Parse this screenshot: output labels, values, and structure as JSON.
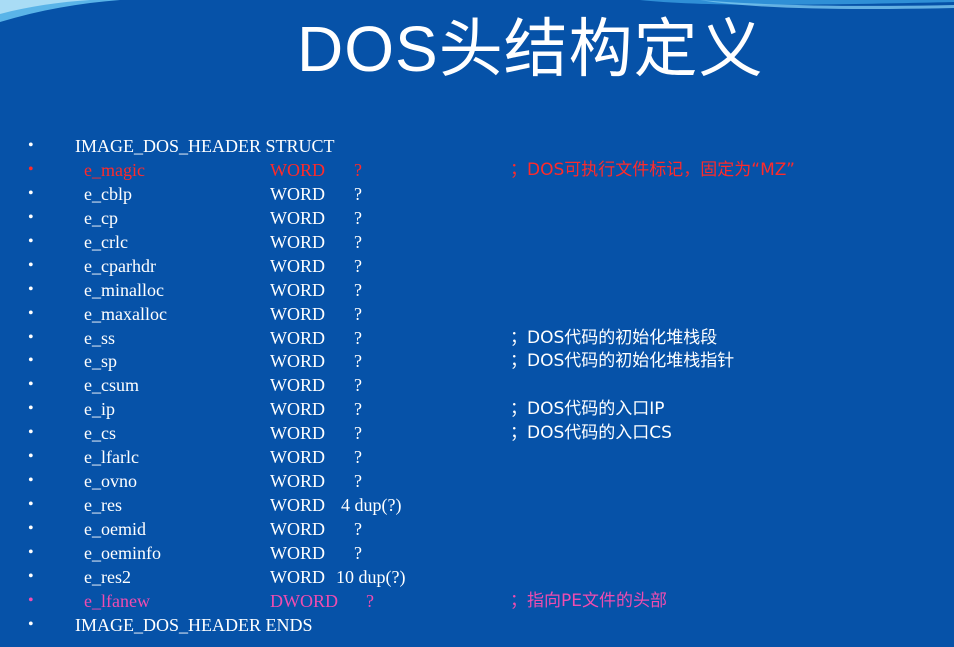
{
  "slide": {
    "title": "DOS头结构定义",
    "colors": {
      "background": "#0652a8",
      "text": "#ffffff",
      "highlight_red": "#ff2a2a",
      "highlight_pink": "#f04cb0"
    }
  },
  "code": {
    "bullet": "•",
    "struct_open": "IMAGE_DOS_HEADER STRUCT",
    "struct_close": "IMAGE_DOS_HEADER ENDS",
    "fields": [
      {
        "name": "e_magic",
        "type": "WORD",
        "value": "?",
        "comment": "；DOS可执行文件标记，固定为“MZ”",
        "color": "red"
      },
      {
        "name": "e_cblp",
        "type": "WORD",
        "value": "?",
        "comment": ""
      },
      {
        "name": "e_cp",
        "type": "WORD",
        "value": "?",
        "comment": ""
      },
      {
        "name": "e_crlc",
        "type": "WORD",
        "value": "?",
        "comment": ""
      },
      {
        "name": "e_cparhdr",
        "type": "WORD",
        "value": "?",
        "comment": ""
      },
      {
        "name": "e_minalloc",
        "type": "WORD",
        "value": "?",
        "comment": ""
      },
      {
        "name": "e_maxalloc",
        "type": "WORD",
        "value": "?",
        "comment": ""
      },
      {
        "name": "e_ss",
        "type": "WORD",
        "value": "?",
        "comment": "；DOS代码的初始化堆栈段"
      },
      {
        "name": "e_sp",
        "type": "WORD",
        "value": "?",
        "comment": "；DOS代码的初始化堆栈指针"
      },
      {
        "name": "e_csum",
        "type": "WORD",
        "value": "?",
        "comment": ""
      },
      {
        "name": "e_ip",
        "type": "WORD",
        "value": "?",
        "comment": "；DOS代码的入口IP"
      },
      {
        "name": "e_cs",
        "type": "WORD",
        "value": "?",
        "comment": "；DOS代码的入口CS"
      },
      {
        "name": "e_lfarlc",
        "type": "WORD",
        "value": "?",
        "comment": ""
      },
      {
        "name": "e_ovno",
        "type": "WORD",
        "value": "?",
        "comment": ""
      },
      {
        "name": "e_res",
        "type": "WORD",
        "value": "4 dup(?)",
        "comment": ""
      },
      {
        "name": "e_oemid",
        "type": "WORD",
        "value": "?",
        "comment": ""
      },
      {
        "name": "e_oeminfo",
        "type": "WORD",
        "value": "?",
        "comment": ""
      },
      {
        "name": "e_res2",
        "type": "WORD",
        "value": "10 dup(?)",
        "comment": ""
      },
      {
        "name": "e_lfanew",
        "type": "DWORD",
        "value": "?",
        "comment": "；指向PE文件的头部",
        "color": "pink"
      }
    ]
  }
}
